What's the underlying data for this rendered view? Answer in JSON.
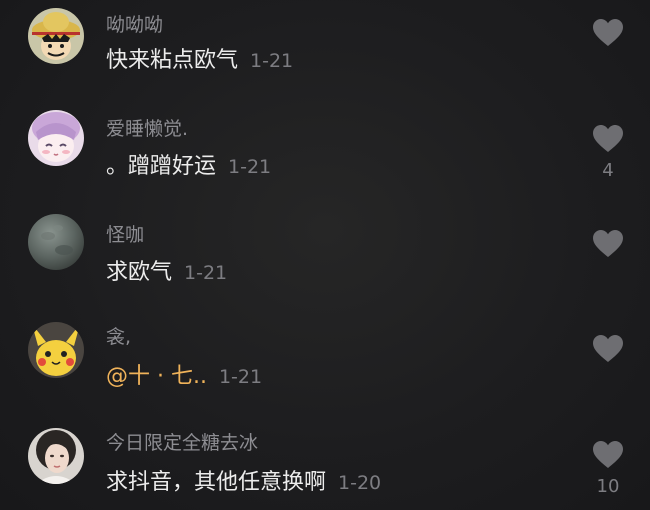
{
  "comments": [
    {
      "username": "呦呦呦",
      "text": "快来粘点欧气",
      "time": "1-21",
      "likes": "",
      "avatar_icon": "luffy-avatar"
    },
    {
      "username": "爱睡懒觉.",
      "text": "。蹭蹭好运",
      "time": "1-21",
      "likes": "4",
      "avatar_icon": "anime-girl-avatar"
    },
    {
      "username": "怪咖",
      "text": "求欧气",
      "time": "1-21",
      "likes": "",
      "avatar_icon": "gray-planet-avatar"
    },
    {
      "username": "衾,",
      "text": "@十 · 七..",
      "time": "1-21",
      "likes": "",
      "avatar_icon": "pikachu-avatar"
    },
    {
      "username": "今日限定全糖去冰",
      "text": "求抖音，其他任意换啊",
      "time": "1-20",
      "likes": "10",
      "avatar_icon": "woman-photo-avatar"
    }
  ],
  "colors": {
    "background": "#1c1c1e",
    "username": "#8d8d92",
    "text": "#ececec",
    "mention": "#f0b35a",
    "heart": "#6e6e72"
  }
}
